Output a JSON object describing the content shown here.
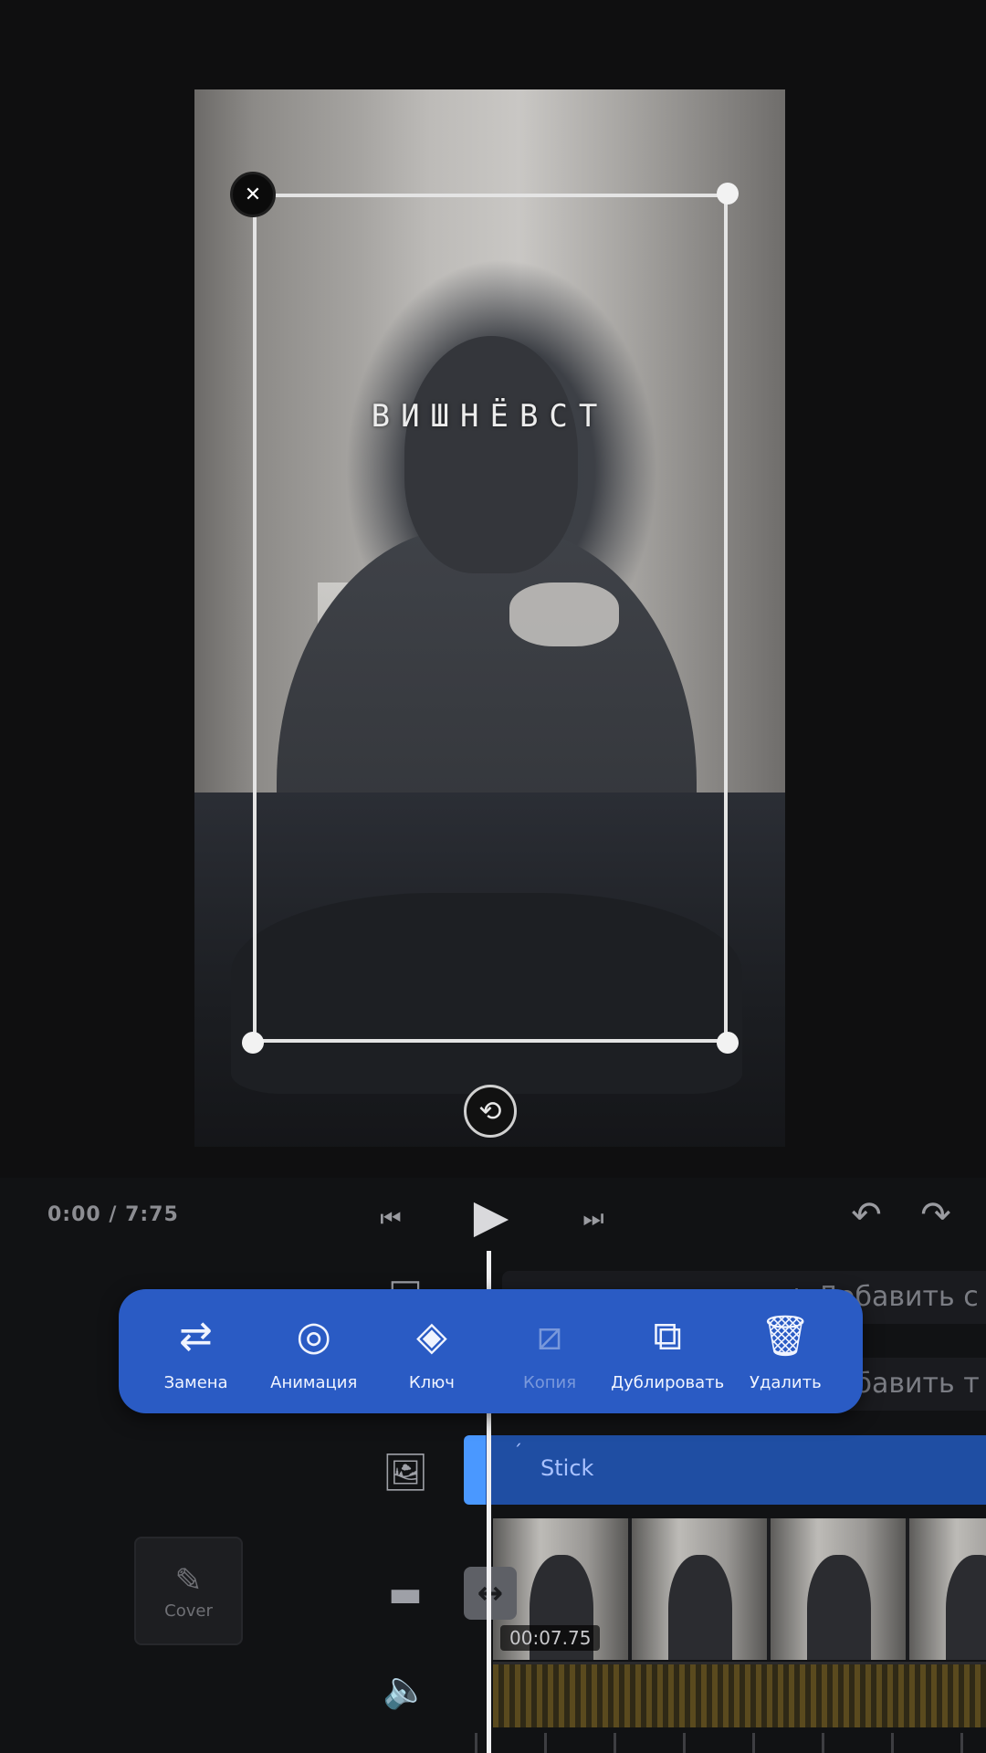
{
  "preview": {
    "overlay_text": "ВИШНЁВСТ"
  },
  "controls": {
    "time": "0:00 / 7:75"
  },
  "toolbar": {
    "tools": [
      {
        "label": "Замена",
        "icon": "replace-icon"
      },
      {
        "label": "Анимация",
        "icon": "animation-icon"
      },
      {
        "label": "Ключ",
        "icon": "keyframe-icon"
      },
      {
        "label": "Копия",
        "icon": "copy-icon",
        "disabled": true
      },
      {
        "label": "Дублировать",
        "icon": "duplicate-icon"
      },
      {
        "label": "Удалить",
        "icon": "delete-icon"
      }
    ]
  },
  "timeline": {
    "hint_1": "+ Добавить с",
    "hint_2": "+ Добавить т",
    "clip_label": "Stick",
    "cover_label": "Cover",
    "duration": "00:07.75"
  },
  "colors": {
    "accent": "#2a5bc4",
    "clip": "#1f4ea3",
    "background": "#0f0f10"
  }
}
